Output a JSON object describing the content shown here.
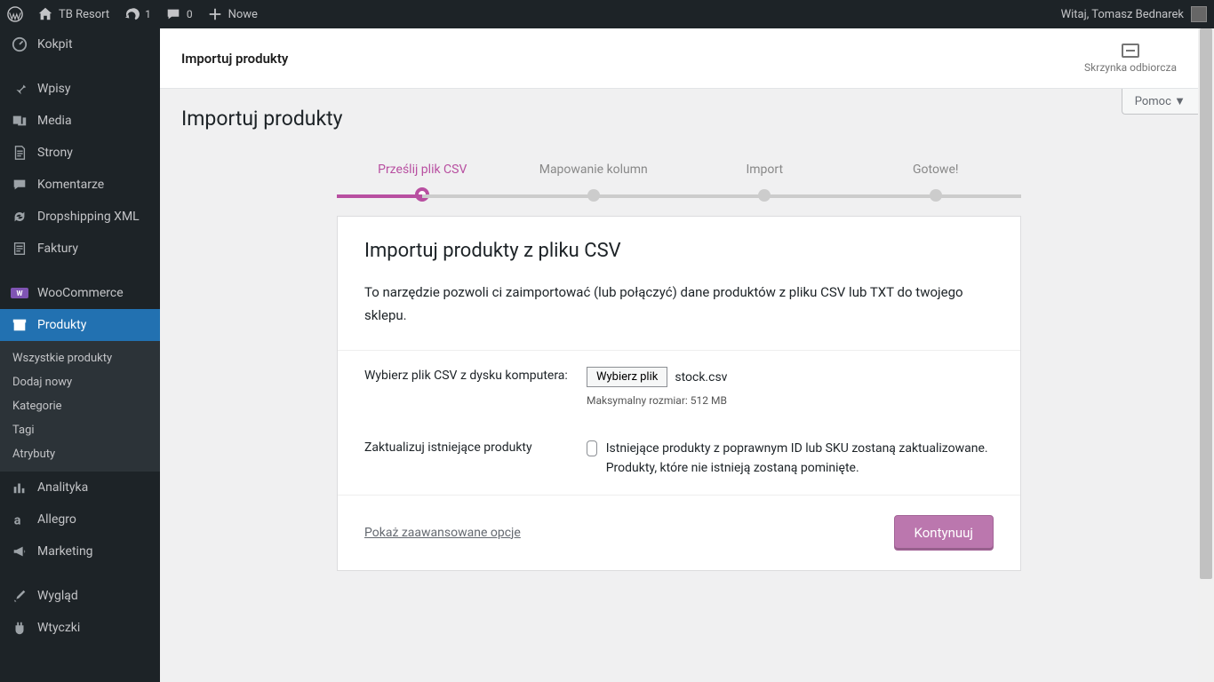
{
  "adminbar": {
    "site_name": "TB Resort",
    "updates_count": "1",
    "comments_count": "0",
    "new_label": "Nowe",
    "greeting": "Witaj, Tomasz Bednarek"
  },
  "sidebar": {
    "items": [
      {
        "label": "Kokpit",
        "icon": "dashboard"
      },
      {
        "label": "Wpisy",
        "icon": "pin"
      },
      {
        "label": "Media",
        "icon": "media"
      },
      {
        "label": "Strony",
        "icon": "pages"
      },
      {
        "label": "Komentarze",
        "icon": "comments"
      },
      {
        "label": "Dropshipping XML",
        "icon": "refresh"
      },
      {
        "label": "Faktury",
        "icon": "invoice"
      },
      {
        "label": "WooCommerce",
        "icon": "woo"
      },
      {
        "label": "Produkty",
        "icon": "archive",
        "current": true
      },
      {
        "label": "Analityka",
        "icon": "stats"
      },
      {
        "label": "Allegro",
        "icon": "a"
      },
      {
        "label": "Marketing",
        "icon": "megaphone"
      },
      {
        "label": "Wygląd",
        "icon": "brush"
      },
      {
        "label": "Wtyczki",
        "icon": "plugin"
      }
    ],
    "submenu": [
      "Wszystkie produkty",
      "Dodaj nowy",
      "Kategorie",
      "Tagi",
      "Atrybuty"
    ]
  },
  "header": {
    "bar_title": "Importuj produkty",
    "inbox_label": "Skrzynka odbiorcza",
    "help_label": "Pomoc",
    "page_title": "Importuj produkty"
  },
  "steps": [
    "Prześlij plik CSV",
    "Mapowanie kolumn",
    "Import",
    "Gotowe!"
  ],
  "card": {
    "title": "Importuj produkty z pliku CSV",
    "desc": "To narzędzie pozwoli ci zaimportować (lub połączyć) dane produktów z pliku CSV lub TXT do twojego sklepu.",
    "file_label": "Wybierz plik CSV z dysku komputera:",
    "file_button": "Wybierz plik",
    "file_name": "stock.csv",
    "max_size": "Maksymalny rozmiar: 512 MB",
    "update_label": "Zaktualizuj istniejące produkty",
    "update_desc": "Istniejące produkty z poprawnym ID lub SKU zostaną zaktualizowane. Produkty, które nie istnieją zostaną pominięte.",
    "advanced": "Pokaż zaawansowane opcje",
    "continue": "Kontynuuj"
  }
}
